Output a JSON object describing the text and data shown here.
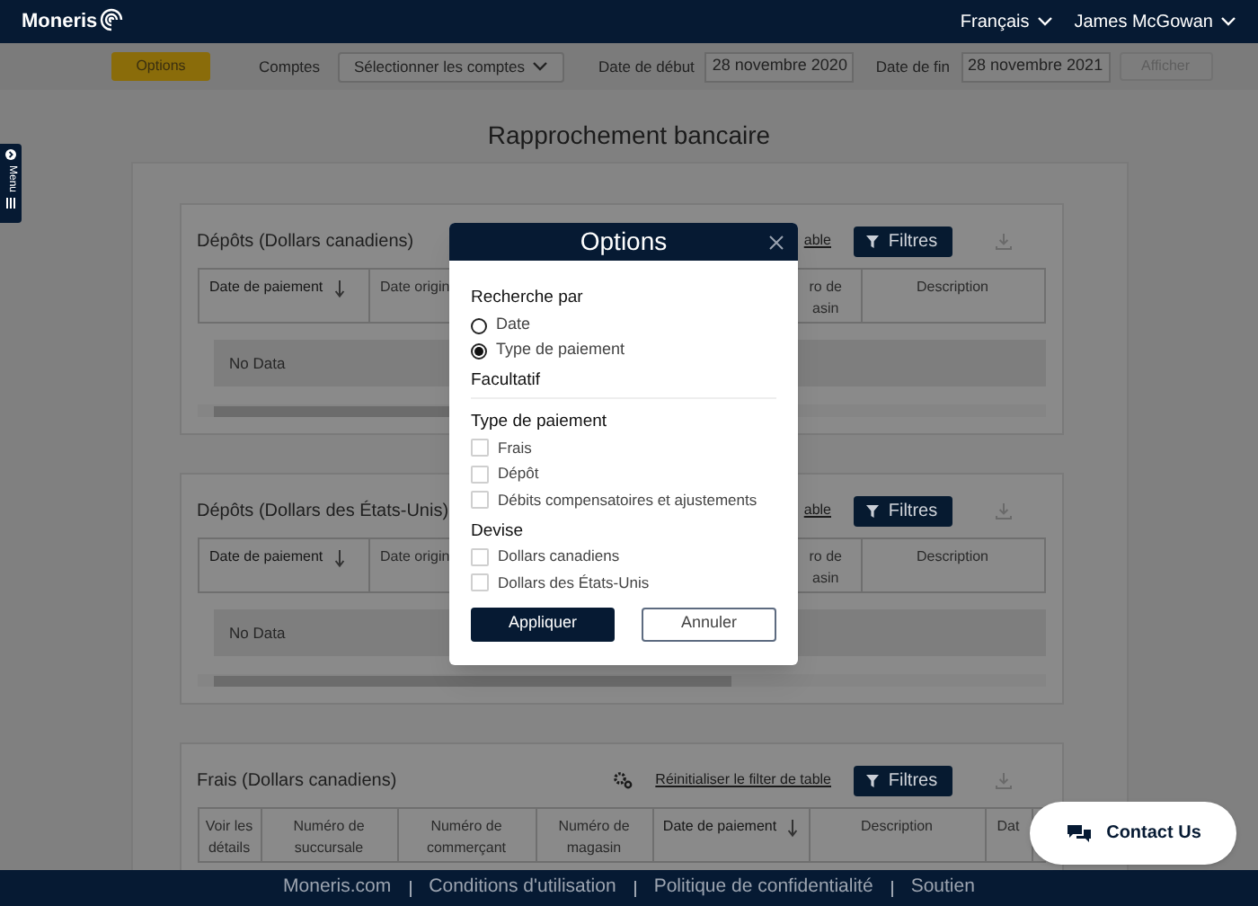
{
  "header": {
    "logo": "Moneris",
    "language": "Français",
    "user": "James McGowan"
  },
  "toolbar": {
    "options_button": "Options",
    "accounts_label": "Comptes",
    "accounts_select": "Sélectionner les comptes",
    "start_label": "Date de début",
    "start_value": "28 novembre 2020",
    "end_label": "Date de fin",
    "end_value": "28 novembre 2021",
    "show_button": {
      "label": "Afficher",
      "disabled": true
    }
  },
  "side_menu": {
    "label": "Menu"
  },
  "page_title": "Rapprochement bancaire",
  "sections": [
    {
      "kind": "deposit",
      "title": "Dépôts (Dollars canadiens)",
      "reset_link": "able",
      "filter_button": "Filtres",
      "columns": [
        {
          "label": "Date de paiement",
          "sorted": true
        },
        {
          "label": "Date origin",
          "sorted": false
        },
        {
          "label": "ro de\nasin",
          "sorted": false
        },
        {
          "label": "Description",
          "sorted": false
        }
      ],
      "empty_text": "No Data"
    },
    {
      "kind": "deposit",
      "title": "Dépôts (Dollars des États-Unis)",
      "reset_link": "able",
      "filter_button": "Filtres",
      "columns": [
        {
          "label": "Date de paiement",
          "sorted": true
        },
        {
          "label": "Date origin",
          "sorted": false
        },
        {
          "label": "ro de\nasin",
          "sorted": false
        },
        {
          "label": "Description",
          "sorted": false
        }
      ],
      "empty_text": "No Data"
    },
    {
      "kind": "fees",
      "title": "Frais (Dollars canadiens)",
      "reset_link": "Réinitialiser le filter de table",
      "filter_button": "Filtres",
      "columns": [
        {
          "label": "Voir les détails",
          "sorted": false
        },
        {
          "label": "Numéro de succursale",
          "sorted": false
        },
        {
          "label": "Numéro de commerçant",
          "sorted": false
        },
        {
          "label": "Numéro de magasin",
          "sorted": false
        },
        {
          "label": "Date de paiement",
          "sorted": true
        },
        {
          "label": "Description",
          "sorted": false
        },
        {
          "label": "Dat",
          "sorted": false
        }
      ]
    }
  ],
  "modal": {
    "title": "Options",
    "search_by_label": "Recherche par",
    "search_by": [
      {
        "label": "Date",
        "selected": false
      },
      {
        "label": "Type de paiement",
        "selected": true
      }
    ],
    "optional_label": "Facultatif",
    "payment_type_label": "Type de paiement",
    "payment_types": [
      {
        "label": "Frais",
        "checked": false
      },
      {
        "label": "Dépôt",
        "checked": false
      },
      {
        "label": "Débits compensatoires et ajustements",
        "checked": false
      }
    ],
    "currency_label": "Devise",
    "currencies": [
      {
        "label": "Dollars canadiens",
        "checked": false
      },
      {
        "label": "Dollars des États-Unis",
        "checked": false
      }
    ],
    "apply_button": "Appliquer",
    "cancel_button": "Annuler"
  },
  "contact_button": "Contact Us",
  "footer": {
    "links": [
      "Moneris.com",
      "Conditions d'utilisation",
      "Politique de confidentialité",
      "Soutien"
    ]
  }
}
